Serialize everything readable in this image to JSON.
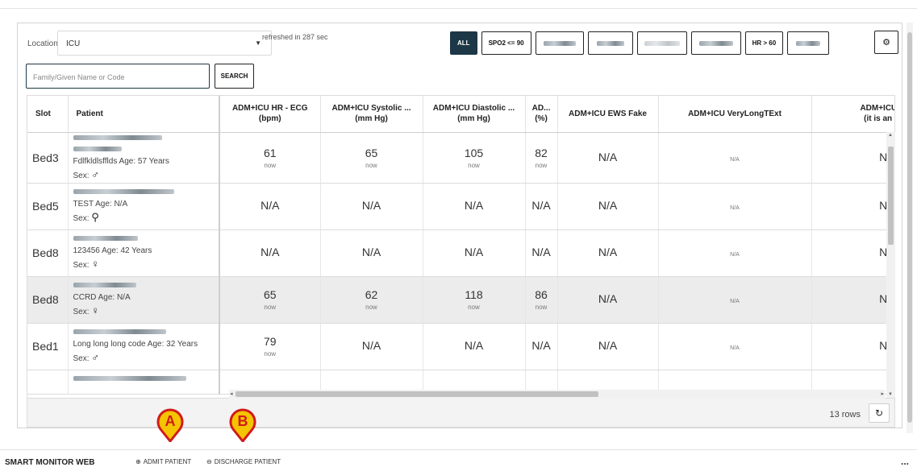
{
  "toolbar": {
    "location_label": "Location",
    "location_value": "ICU",
    "refreshed": "refreshed in 287 sec",
    "filters": [
      "ALL",
      "SPO2 <= 90",
      "",
      "",
      "",
      "",
      "HR > 60",
      ""
    ],
    "search_placeholder": "Family/Given Name or Code",
    "search_label": "SEARCH"
  },
  "table": {
    "columns": [
      "Slot",
      "Patient",
      "ADM+ICU HR - ECG\n(bpm)",
      "ADM+ICU Systolic ...\n(mm Hg)",
      "ADM+ICU Diastolic ...\n(mm Hg)",
      "AD...\n(%)",
      "ADM+ICU EWS Fake",
      "ADM+ICU VeryLongTExt",
      "ADM+ICU Ico\n(it is an icon"
    ],
    "rows": [
      {
        "slot": "Bed3",
        "patient_info": "Fdlfkldlsfflds Age: 57 Years",
        "sex": "♂",
        "hr": "61",
        "hr_time": "now",
        "sys": "65",
        "sys_time": "now",
        "dia": "105",
        "dia_time": "now",
        "spo2": "82",
        "spo2_time": "now",
        "ews": "N/A",
        "vlt": "N/A",
        "icon": "N/A",
        "highlight": false
      },
      {
        "slot": "Bed5",
        "patient_info": "TEST Age: N/A",
        "sex": "⚲",
        "hr": "N/A",
        "sys": "N/A",
        "dia": "N/A",
        "spo2": "N/A",
        "ews": "N/A",
        "vlt": "N/A",
        "icon": "N/A",
        "highlight": false
      },
      {
        "slot": "Bed8",
        "patient_info": "123456 Age: 42 Years",
        "sex": "♀",
        "hr": "N/A",
        "sys": "N/A",
        "dia": "N/A",
        "spo2": "N/A",
        "ews": "N/A",
        "vlt": "N/A",
        "icon": "N/A",
        "highlight": false
      },
      {
        "slot": "Bed8",
        "patient_info": "CCRD Age: N/A",
        "sex": "♀",
        "hr": "65",
        "hr_time": "now",
        "sys": "62",
        "sys_time": "now",
        "dia": "118",
        "dia_time": "now",
        "spo2": "86",
        "spo2_time": "now",
        "ews": "N/A",
        "vlt": "N/A",
        "icon": "N/A",
        "highlight": true
      },
      {
        "slot": "Bed1",
        "patient_info": "Long long long code Age: 32 Years",
        "sex": "♂",
        "hr": "79",
        "hr_time": "now",
        "sys": "N/A",
        "dia": "N/A",
        "spo2": "N/A",
        "ews": "N/A",
        "vlt": "N/A",
        "icon": "N/A",
        "highlight": false
      }
    ],
    "sex_label": "Sex:",
    "row_count": "13 rows"
  },
  "footer": {
    "app_title": "SMART MONITOR WEB",
    "admit_label": "ADMIT PATIENT",
    "discharge_label": "DISCHARGE PATIENT",
    "more": "..."
  },
  "callouts": {
    "a": "A",
    "b": "B"
  },
  "colors": {
    "accent_dark": "#1c3745",
    "callout_fill": "#f5c400",
    "callout_stroke": "#d11a1a"
  }
}
